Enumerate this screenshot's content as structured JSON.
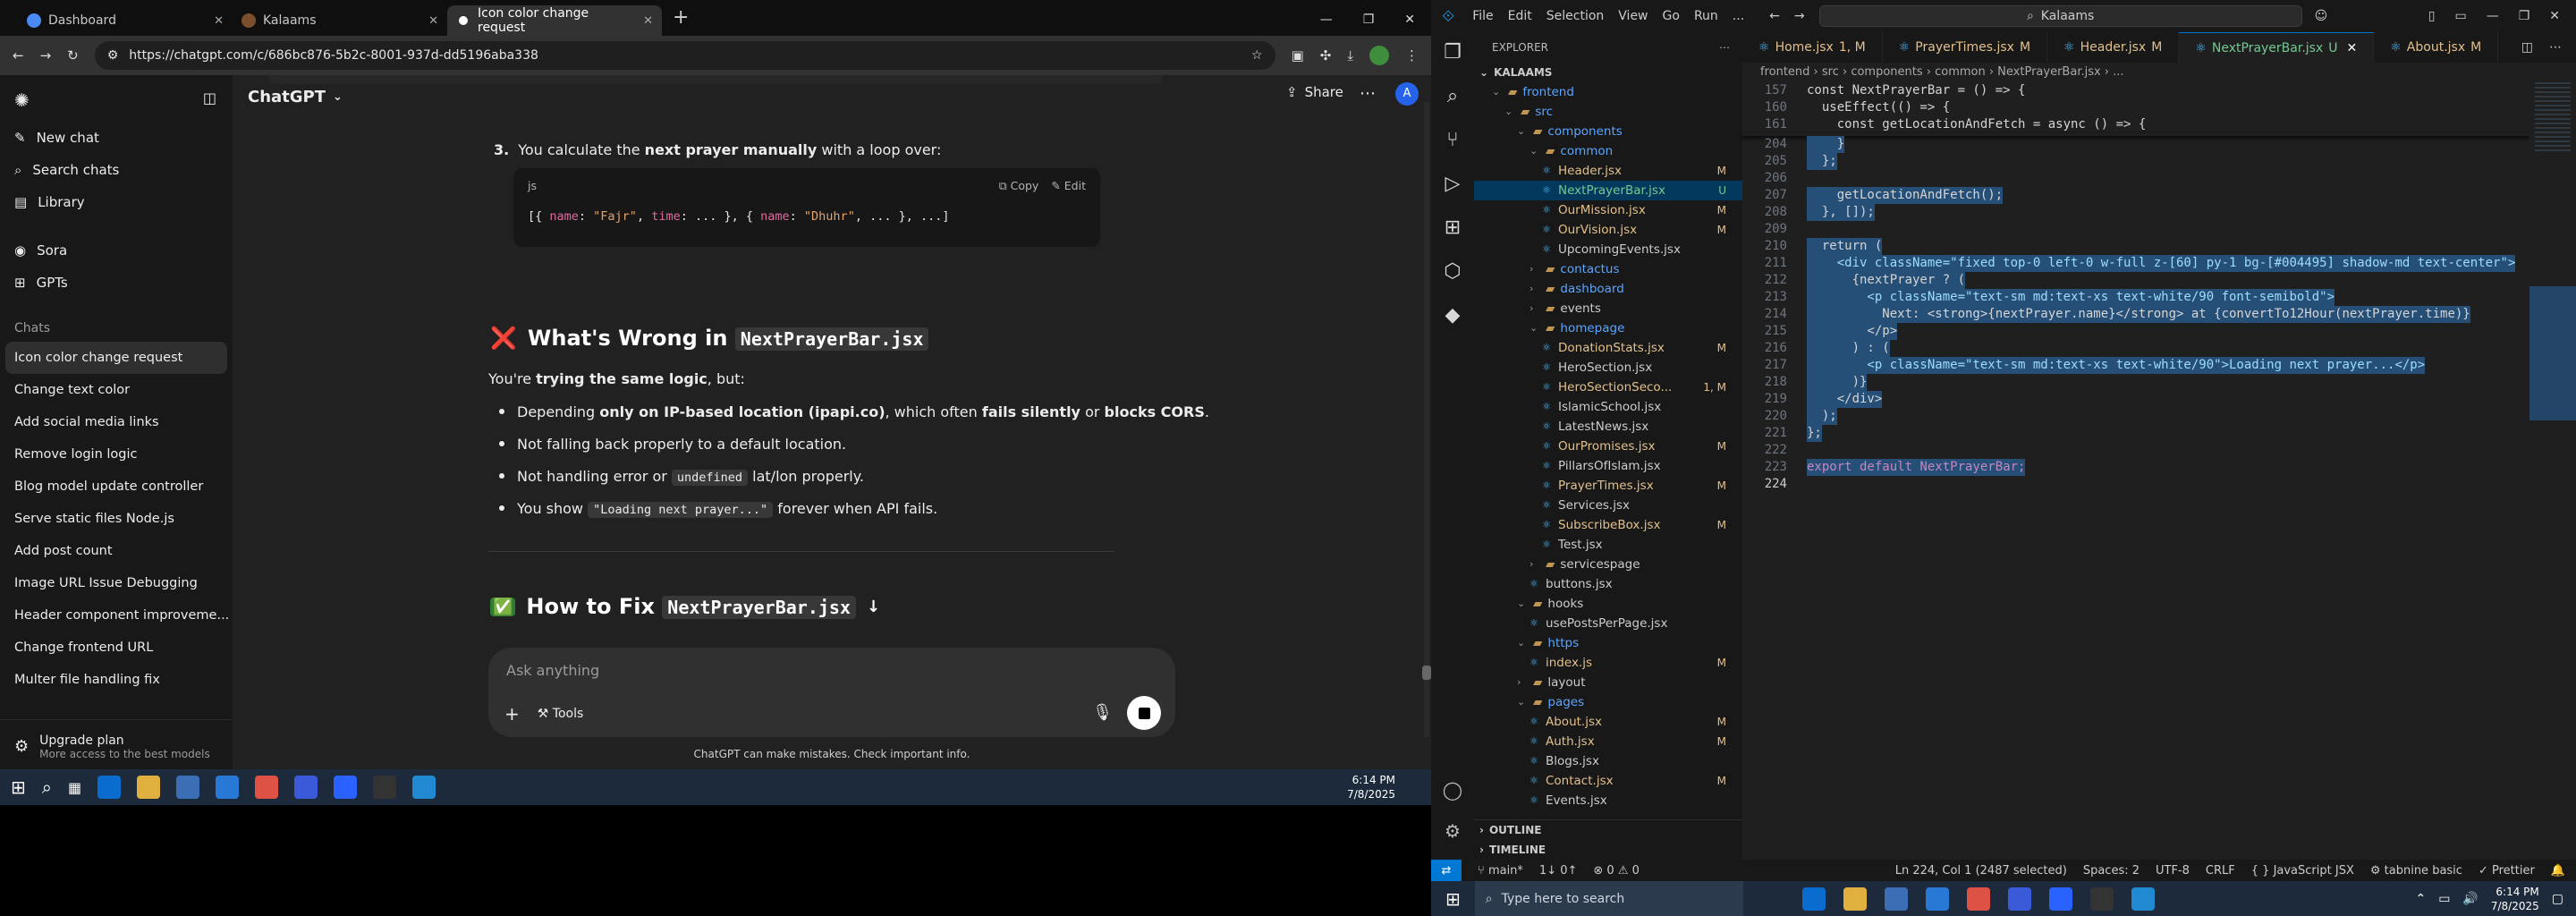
{
  "chrome": {
    "tabs": [
      {
        "title": "Dashboard",
        "active": false
      },
      {
        "title": "Kalaams",
        "active": false
      },
      {
        "title": "Icon color change request",
        "active": true
      }
    ],
    "url": "https://chatgpt.com/c/686bc876-5b2c-8001-937d-dd5196aba338",
    "new_tab": "+",
    "avatar": "A"
  },
  "chatgpt": {
    "nav": [
      "New chat",
      "Search chats",
      "Library"
    ],
    "apps": [
      "Sora",
      "GPTs"
    ],
    "chats_heading": "Chats",
    "chats": [
      "Icon color change request",
      "Change text color",
      "Add social media links",
      "Remove login logic",
      "Blog model update controller",
      "Serve static files Node.js",
      "Add post count",
      "Image URL Issue Debugging",
      "Header component improveme...",
      "Change frontend URL",
      "Multer file handling fix"
    ],
    "upgrade_title": "Upgrade plan",
    "upgrade_sub": "More access to the best models",
    "model": "ChatGPT",
    "share": "Share",
    "step_num": "3.",
    "step_a": "You calculate the ",
    "step_b": "next prayer manually",
    "step_c": " with a loop over:",
    "code_lang": "js",
    "copy": "Copy",
    "edit": "Edit",
    "code_parts": [
      "[{ ",
      "name",
      ": ",
      "\"Fajr\"",
      ", ",
      "time",
      ": ... }, { ",
      "name",
      ": ",
      "\"Dhuhr\"",
      ", ... }, ...]"
    ],
    "h_wrong_emoji": "❌",
    "h_wrong_text": "What's Wrong in ",
    "h_wrong_code": "NextPrayerBar.jsx",
    "para_a": "You're ",
    "para_b": "trying the same logic",
    "para_c": ", but:",
    "b1": [
      "Depending ",
      "only on IP-based location (ipapi.co)",
      ", which often ",
      "fails silently",
      " or ",
      "blocks CORS",
      "."
    ],
    "b2": "Not falling back properly to a default location.",
    "b3": [
      "Not handling error or ",
      "undefined",
      " lat/lon properly."
    ],
    "b4": [
      "You show ",
      "\"Loading next prayer...\"",
      " forever when API fails."
    ],
    "h_fix_emoji": "✅",
    "h_fix_text": "How to Fix ",
    "h_fix_code": "NextPrayerBar.jsx",
    "composer_placeholder": "Ask anything",
    "tools": "Tools",
    "disclaimer": "ChatGPT can make mistakes. Check important info."
  },
  "taskbar1": {
    "time": "6:14 PM",
    "date": "7/8/2025"
  },
  "vscode": {
    "menu": [
      "File",
      "Edit",
      "Selection",
      "View",
      "Go",
      "Run",
      "..."
    ],
    "search": "Kalaams",
    "explorer_title": "EXPLORER",
    "root": "KALAAMS",
    "tree": [
      {
        "name": "frontend",
        "depth": 1,
        "folder": true,
        "open": true,
        "badge": "",
        "color": "#5ba5ff"
      },
      {
        "name": "src",
        "depth": 2,
        "folder": true,
        "open": true,
        "badge": "",
        "color": "#5ba5ff"
      },
      {
        "name": "components",
        "depth": 3,
        "folder": true,
        "open": true,
        "badge": "",
        "color": "#5ba5ff"
      },
      {
        "name": "common",
        "depth": 4,
        "folder": true,
        "open": true,
        "badge": "",
        "color": "#5ba5ff"
      },
      {
        "name": "Header.jsx",
        "depth": 5,
        "folder": false,
        "badge": "M",
        "color": "#e2c08d"
      },
      {
        "name": "NextPrayerBar.jsx",
        "depth": 5,
        "folder": false,
        "badge": "U",
        "color": "#73c991",
        "sel": true
      },
      {
        "name": "OurMission.jsx",
        "depth": 5,
        "folder": false,
        "badge": "M",
        "color": "#e2c08d"
      },
      {
        "name": "OurVision.jsx",
        "depth": 5,
        "folder": false,
        "badge": "M",
        "color": "#e2c08d"
      },
      {
        "name": "UpcomingEvents.jsx",
        "depth": 5,
        "folder": false,
        "badge": "",
        "color": "#cccccc"
      },
      {
        "name": "contactus",
        "depth": 4,
        "folder": true,
        "open": false,
        "badge": "",
        "color": "#5ba5ff"
      },
      {
        "name": "dashboard",
        "depth": 4,
        "folder": true,
        "open": false,
        "badge": "",
        "color": "#5ba5ff"
      },
      {
        "name": "events",
        "depth": 4,
        "folder": true,
        "open": false,
        "badge": "",
        "color": "#cccccc"
      },
      {
        "name": "homepage",
        "depth": 4,
        "folder": true,
        "open": true,
        "badge": "",
        "color": "#5ba5ff"
      },
      {
        "name": "DonationStats.jsx",
        "depth": 5,
        "folder": false,
        "badge": "M",
        "color": "#e2c08d"
      },
      {
        "name": "HeroSection.jsx",
        "depth": 5,
        "folder": false,
        "badge": "",
        "color": "#cccccc"
      },
      {
        "name": "HeroSectionSeco...",
        "depth": 5,
        "folder": false,
        "badge": "1, M",
        "color": "#e2c08d"
      },
      {
        "name": "IslamicSchool.jsx",
        "depth": 5,
        "folder": false,
        "badge": "",
        "color": "#cccccc"
      },
      {
        "name": "LatestNews.jsx",
        "depth": 5,
        "folder": false,
        "badge": "",
        "color": "#cccccc"
      },
      {
        "name": "OurPromises.jsx",
        "depth": 5,
        "folder": false,
        "badge": "M",
        "color": "#e2c08d"
      },
      {
        "name": "PillarsOfIslam.jsx",
        "depth": 5,
        "folder": false,
        "badge": "",
        "color": "#cccccc"
      },
      {
        "name": "PrayerTimes.jsx",
        "depth": 5,
        "folder": false,
        "badge": "M",
        "color": "#e2c08d"
      },
      {
        "name": "Services.jsx",
        "depth": 5,
        "folder": false,
        "badge": "",
        "color": "#cccccc"
      },
      {
        "name": "SubscribeBox.jsx",
        "depth": 5,
        "folder": false,
        "badge": "M",
        "color": "#e2c08d"
      },
      {
        "name": "Test.jsx",
        "depth": 5,
        "folder": false,
        "badge": "",
        "color": "#cccccc"
      },
      {
        "name": "servicespage",
        "depth": 4,
        "folder": true,
        "open": false,
        "badge": "",
        "color": "#cccccc"
      },
      {
        "name": "buttons.jsx",
        "depth": 4,
        "folder": false,
        "badge": "",
        "color": "#cccccc"
      },
      {
        "name": "hooks",
        "depth": 3,
        "folder": true,
        "open": true,
        "badge": "",
        "color": "#cccccc"
      },
      {
        "name": "usePostsPerPage.jsx",
        "depth": 4,
        "folder": false,
        "badge": "",
        "color": "#cccccc"
      },
      {
        "name": "https",
        "depth": 3,
        "folder": true,
        "open": true,
        "badge": "",
        "color": "#5ba5ff"
      },
      {
        "name": "index.js",
        "depth": 4,
        "folder": false,
        "badge": "M",
        "color": "#e2c08d"
      },
      {
        "name": "layout",
        "depth": 3,
        "folder": true,
        "open": false,
        "badge": "",
        "color": "#cccccc"
      },
      {
        "name": "pages",
        "depth": 3,
        "folder": true,
        "open": true,
        "badge": "",
        "color": "#5ba5ff"
      },
      {
        "name": "About.jsx",
        "depth": 4,
        "folder": false,
        "badge": "M",
        "color": "#e2c08d"
      },
      {
        "name": "Auth.jsx",
        "depth": 4,
        "folder": false,
        "badge": "M",
        "color": "#e2c08d"
      },
      {
        "name": "Blogs.jsx",
        "depth": 4,
        "folder": false,
        "badge": "",
        "color": "#cccccc"
      },
      {
        "name": "Contact.jsx",
        "depth": 4,
        "folder": false,
        "badge": "M",
        "color": "#e2c08d"
      },
      {
        "name": "Events.jsx",
        "depth": 4,
        "folder": false,
        "badge": "",
        "color": "#cccccc"
      }
    ],
    "outline": "OUTLINE",
    "timeline": "TIMELINE",
    "tabs": [
      {
        "name": "Home.jsx",
        "badge": "1, M",
        "active": false
      },
      {
        "name": "PrayerTimes.jsx",
        "badge": "M",
        "active": false
      },
      {
        "name": "Header.jsx",
        "badge": "M",
        "active": false
      },
      {
        "name": "NextPrayerBar.jsx",
        "badge": "U",
        "active": true
      },
      {
        "name": "About.jsx",
        "badge": "M",
        "active": false
      }
    ],
    "breadcrumb": "frontend › src › components › common › NextPrayerBar.jsx › ...",
    "sticky": [
      {
        "n": "157",
        "t": "const NextPrayerBar = () => {"
      },
      {
        "n": "160",
        "t": "  useEffect(() => {"
      },
      {
        "n": "161",
        "t": "    const getLocationAndFetch = async () => {"
      }
    ],
    "lines": [
      {
        "n": "204",
        "t": "    }"
      },
      {
        "n": "205",
        "t": "  };"
      },
      {
        "n": "206",
        "t": ""
      },
      {
        "n": "207",
        "t": "    getLocationAndFetch();"
      },
      {
        "n": "208",
        "t": "  }, []);"
      },
      {
        "n": "209",
        "t": ""
      },
      {
        "n": "210",
        "t": "  return ("
      },
      {
        "n": "211",
        "t": "    <div className=\"fixed top-0 left-0 w-full z-[60] py-1 bg-[#004495] shadow-md text-center\">"
      },
      {
        "n": "212",
        "t": "      {nextPrayer ? ("
      },
      {
        "n": "213",
        "t": "        <p className=\"text-sm md:text-xs text-white/90 font-semibold\">"
      },
      {
        "n": "214",
        "t": "          Next: <strong>{nextPrayer.name}</strong> at {convertTo12Hour(nextPrayer.time)}"
      },
      {
        "n": "215",
        "t": "        </p>"
      },
      {
        "n": "216",
        "t": "      ) : ("
      },
      {
        "n": "217",
        "t": "        <p className=\"text-sm md:text-xs text-white/90\">Loading next prayer...</p>"
      },
      {
        "n": "218",
        "t": "      )}"
      },
      {
        "n": "219",
        "t": "    </div>"
      },
      {
        "n": "220",
        "t": "  );"
      },
      {
        "n": "221",
        "t": "};"
      },
      {
        "n": "222",
        "t": ""
      },
      {
        "n": "223",
        "t": "export default NextPrayerBar;"
      },
      {
        "n": "224",
        "t": ""
      }
    ],
    "status": {
      "branch": "main*",
      "sync": "1↓ 0↑",
      "problems": "⊗ 0 ⚠ 0",
      "position": "Ln 224, Col 1 (2487 selected)",
      "spaces": "Spaces: 2",
      "encoding": "UTF-8",
      "eol": "CRLF",
      "lang": "JavaScript JSX",
      "tabnine": "tabnine basic",
      "prettier": "Prettier"
    }
  },
  "taskbar2": {
    "search_placeholder": "Type here to search",
    "time": "6:14 PM",
    "date": "7/8/2025"
  },
  "colors": {
    "chatgpt_bg": "#212121",
    "vscode_accent": "#0078d4",
    "taskbar": "#1c2a3c"
  }
}
